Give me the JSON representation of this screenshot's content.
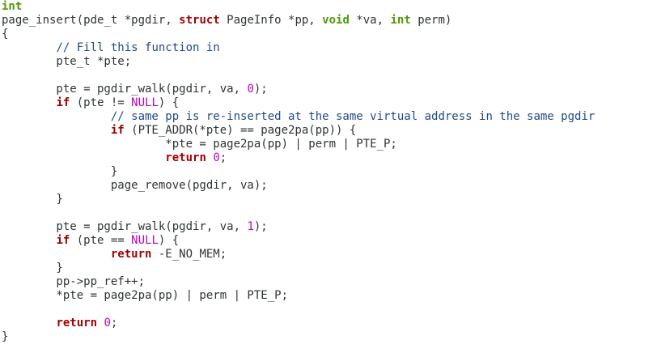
{
  "colors": {
    "type": "#4e9a06",
    "keyword": "#a40000",
    "comment": "#204a87",
    "constant": "#c000c0",
    "plain": "#2e3436",
    "background": "#ffffff"
  },
  "lines": [
    [
      {
        "t": "int",
        "k": "type"
      }
    ],
    [
      {
        "t": "page_insert(pde_t *pgdir, ",
        "k": "plain"
      },
      {
        "t": "struct",
        "k": "kw"
      },
      {
        "t": " PageInfo *pp, ",
        "k": "plain"
      },
      {
        "t": "void",
        "k": "type"
      },
      {
        "t": " *va, ",
        "k": "plain"
      },
      {
        "t": "int",
        "k": "type"
      },
      {
        "t": " perm)",
        "k": "plain"
      }
    ],
    [
      {
        "t": "{",
        "k": "plain"
      }
    ],
    [
      {
        "t": "        ",
        "k": "plain"
      },
      {
        "t": "// Fill this function in",
        "k": "cmt"
      }
    ],
    [
      {
        "t": "        pte_t *pte;",
        "k": "plain"
      }
    ],
    [],
    [
      {
        "t": "        pte = pgdir_walk(pgdir, va, ",
        "k": "plain"
      },
      {
        "t": "0",
        "k": "num"
      },
      {
        "t": ");",
        "k": "plain"
      }
    ],
    [
      {
        "t": "        ",
        "k": "plain"
      },
      {
        "t": "if",
        "k": "kw"
      },
      {
        "t": " (pte != ",
        "k": "plain"
      },
      {
        "t": "NULL",
        "k": "const"
      },
      {
        "t": ") {",
        "k": "plain"
      }
    ],
    [
      {
        "t": "                ",
        "k": "plain"
      },
      {
        "t": "// same pp is re-inserted at the same virtual address in the same pgdir",
        "k": "cmt"
      }
    ],
    [
      {
        "t": "                ",
        "k": "plain"
      },
      {
        "t": "if",
        "k": "kw"
      },
      {
        "t": " (PTE_ADDR(*pte) == page2pa(pp)) {",
        "k": "plain"
      }
    ],
    [
      {
        "t": "                        *pte = page2pa(pp) | perm | PTE_P;",
        "k": "plain"
      }
    ],
    [
      {
        "t": "                        ",
        "k": "plain"
      },
      {
        "t": "return",
        "k": "kw"
      },
      {
        "t": " ",
        "k": "plain"
      },
      {
        "t": "0",
        "k": "num"
      },
      {
        "t": ";",
        "k": "plain"
      }
    ],
    [
      {
        "t": "                }",
        "k": "plain"
      }
    ],
    [
      {
        "t": "                page_remove(pgdir, va);",
        "k": "plain"
      }
    ],
    [
      {
        "t": "        }",
        "k": "plain"
      }
    ],
    [],
    [
      {
        "t": "        pte = pgdir_walk(pgdir, va, ",
        "k": "plain"
      },
      {
        "t": "1",
        "k": "num"
      },
      {
        "t": ");",
        "k": "plain"
      }
    ],
    [
      {
        "t": "        ",
        "k": "plain"
      },
      {
        "t": "if",
        "k": "kw"
      },
      {
        "t": " (pte == ",
        "k": "plain"
      },
      {
        "t": "NULL",
        "k": "const"
      },
      {
        "t": ") {",
        "k": "plain"
      }
    ],
    [
      {
        "t": "                ",
        "k": "plain"
      },
      {
        "t": "return",
        "k": "kw"
      },
      {
        "t": " -E_NO_MEM;",
        "k": "plain"
      }
    ],
    [
      {
        "t": "        }",
        "k": "plain"
      }
    ],
    [
      {
        "t": "        pp->pp_ref++;",
        "k": "plain"
      }
    ],
    [
      {
        "t": "        *pte = page2pa(pp) | perm | PTE_P;",
        "k": "plain"
      }
    ],
    [],
    [
      {
        "t": "        ",
        "k": "plain"
      },
      {
        "t": "return",
        "k": "kw"
      },
      {
        "t": " ",
        "k": "plain"
      },
      {
        "t": "0",
        "k": "num"
      },
      {
        "t": ";",
        "k": "plain"
      }
    ],
    [
      {
        "t": "}",
        "k": "plain"
      }
    ]
  ]
}
